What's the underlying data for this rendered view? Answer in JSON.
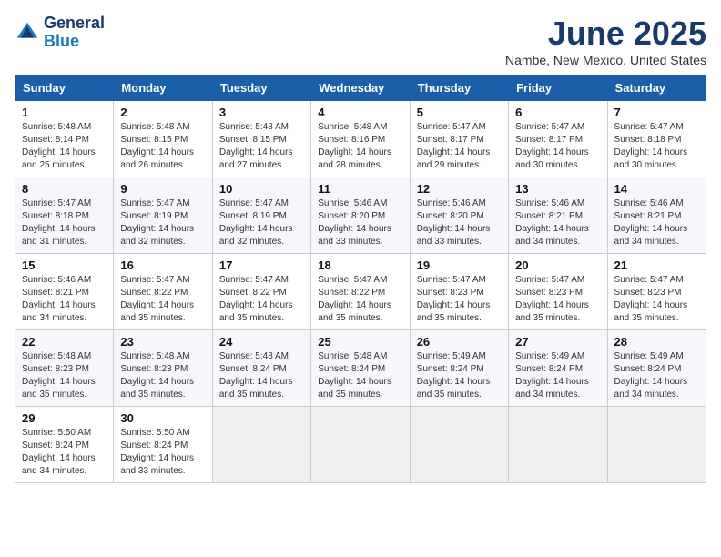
{
  "header": {
    "logo_line1": "General",
    "logo_line2": "Blue",
    "month_title": "June 2025",
    "location": "Nambe, New Mexico, United States"
  },
  "weekdays": [
    "Sunday",
    "Monday",
    "Tuesday",
    "Wednesday",
    "Thursday",
    "Friday",
    "Saturday"
  ],
  "weeks": [
    [
      {
        "day": "1",
        "sunrise": "Sunrise: 5:48 AM",
        "sunset": "Sunset: 8:14 PM",
        "daylight": "Daylight: 14 hours and 25 minutes."
      },
      {
        "day": "2",
        "sunrise": "Sunrise: 5:48 AM",
        "sunset": "Sunset: 8:15 PM",
        "daylight": "Daylight: 14 hours and 26 minutes."
      },
      {
        "day": "3",
        "sunrise": "Sunrise: 5:48 AM",
        "sunset": "Sunset: 8:15 PM",
        "daylight": "Daylight: 14 hours and 27 minutes."
      },
      {
        "day": "4",
        "sunrise": "Sunrise: 5:48 AM",
        "sunset": "Sunset: 8:16 PM",
        "daylight": "Daylight: 14 hours and 28 minutes."
      },
      {
        "day": "5",
        "sunrise": "Sunrise: 5:47 AM",
        "sunset": "Sunset: 8:17 PM",
        "daylight": "Daylight: 14 hours and 29 minutes."
      },
      {
        "day": "6",
        "sunrise": "Sunrise: 5:47 AM",
        "sunset": "Sunset: 8:17 PM",
        "daylight": "Daylight: 14 hours and 30 minutes."
      },
      {
        "day": "7",
        "sunrise": "Sunrise: 5:47 AM",
        "sunset": "Sunset: 8:18 PM",
        "daylight": "Daylight: 14 hours and 30 minutes."
      }
    ],
    [
      {
        "day": "8",
        "sunrise": "Sunrise: 5:47 AM",
        "sunset": "Sunset: 8:18 PM",
        "daylight": "Daylight: 14 hours and 31 minutes."
      },
      {
        "day": "9",
        "sunrise": "Sunrise: 5:47 AM",
        "sunset": "Sunset: 8:19 PM",
        "daylight": "Daylight: 14 hours and 32 minutes."
      },
      {
        "day": "10",
        "sunrise": "Sunrise: 5:47 AM",
        "sunset": "Sunset: 8:19 PM",
        "daylight": "Daylight: 14 hours and 32 minutes."
      },
      {
        "day": "11",
        "sunrise": "Sunrise: 5:46 AM",
        "sunset": "Sunset: 8:20 PM",
        "daylight": "Daylight: 14 hours and 33 minutes."
      },
      {
        "day": "12",
        "sunrise": "Sunrise: 5:46 AM",
        "sunset": "Sunset: 8:20 PM",
        "daylight": "Daylight: 14 hours and 33 minutes."
      },
      {
        "day": "13",
        "sunrise": "Sunrise: 5:46 AM",
        "sunset": "Sunset: 8:21 PM",
        "daylight": "Daylight: 14 hours and 34 minutes."
      },
      {
        "day": "14",
        "sunrise": "Sunrise: 5:46 AM",
        "sunset": "Sunset: 8:21 PM",
        "daylight": "Daylight: 14 hours and 34 minutes."
      }
    ],
    [
      {
        "day": "15",
        "sunrise": "Sunrise: 5:46 AM",
        "sunset": "Sunset: 8:21 PM",
        "daylight": "Daylight: 14 hours and 34 minutes."
      },
      {
        "day": "16",
        "sunrise": "Sunrise: 5:47 AM",
        "sunset": "Sunset: 8:22 PM",
        "daylight": "Daylight: 14 hours and 35 minutes."
      },
      {
        "day": "17",
        "sunrise": "Sunrise: 5:47 AM",
        "sunset": "Sunset: 8:22 PM",
        "daylight": "Daylight: 14 hours and 35 minutes."
      },
      {
        "day": "18",
        "sunrise": "Sunrise: 5:47 AM",
        "sunset": "Sunset: 8:22 PM",
        "daylight": "Daylight: 14 hours and 35 minutes."
      },
      {
        "day": "19",
        "sunrise": "Sunrise: 5:47 AM",
        "sunset": "Sunset: 8:23 PM",
        "daylight": "Daylight: 14 hours and 35 minutes."
      },
      {
        "day": "20",
        "sunrise": "Sunrise: 5:47 AM",
        "sunset": "Sunset: 8:23 PM",
        "daylight": "Daylight: 14 hours and 35 minutes."
      },
      {
        "day": "21",
        "sunrise": "Sunrise: 5:47 AM",
        "sunset": "Sunset: 8:23 PM",
        "daylight": "Daylight: 14 hours and 35 minutes."
      }
    ],
    [
      {
        "day": "22",
        "sunrise": "Sunrise: 5:48 AM",
        "sunset": "Sunset: 8:23 PM",
        "daylight": "Daylight: 14 hours and 35 minutes."
      },
      {
        "day": "23",
        "sunrise": "Sunrise: 5:48 AM",
        "sunset": "Sunset: 8:23 PM",
        "daylight": "Daylight: 14 hours and 35 minutes."
      },
      {
        "day": "24",
        "sunrise": "Sunrise: 5:48 AM",
        "sunset": "Sunset: 8:24 PM",
        "daylight": "Daylight: 14 hours and 35 minutes."
      },
      {
        "day": "25",
        "sunrise": "Sunrise: 5:48 AM",
        "sunset": "Sunset: 8:24 PM",
        "daylight": "Daylight: 14 hours and 35 minutes."
      },
      {
        "day": "26",
        "sunrise": "Sunrise: 5:49 AM",
        "sunset": "Sunset: 8:24 PM",
        "daylight": "Daylight: 14 hours and 35 minutes."
      },
      {
        "day": "27",
        "sunrise": "Sunrise: 5:49 AM",
        "sunset": "Sunset: 8:24 PM",
        "daylight": "Daylight: 14 hours and 34 minutes."
      },
      {
        "day": "28",
        "sunrise": "Sunrise: 5:49 AM",
        "sunset": "Sunset: 8:24 PM",
        "daylight": "Daylight: 14 hours and 34 minutes."
      }
    ],
    [
      {
        "day": "29",
        "sunrise": "Sunrise: 5:50 AM",
        "sunset": "Sunset: 8:24 PM",
        "daylight": "Daylight: 14 hours and 34 minutes."
      },
      {
        "day": "30",
        "sunrise": "Sunrise: 5:50 AM",
        "sunset": "Sunset: 8:24 PM",
        "daylight": "Daylight: 14 hours and 33 minutes."
      },
      null,
      null,
      null,
      null,
      null
    ]
  ]
}
